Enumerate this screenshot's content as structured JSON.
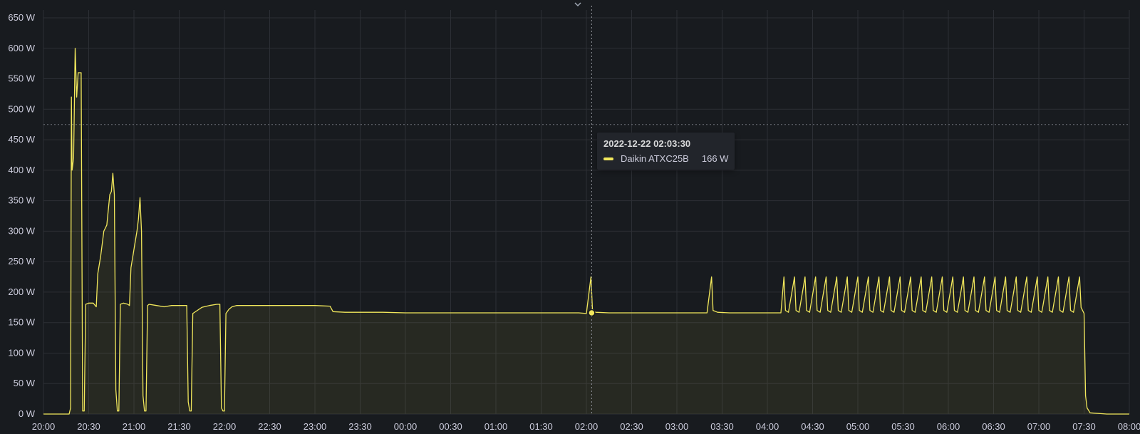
{
  "chart_data": {
    "type": "area",
    "x_axis": {
      "ticks": [
        "20:00",
        "20:30",
        "21:00",
        "21:30",
        "22:00",
        "22:30",
        "23:00",
        "23:30",
        "00:00",
        "00:30",
        "01:00",
        "01:30",
        "02:00",
        "02:30",
        "03:00",
        "03:30",
        "04:00",
        "04:30",
        "05:00",
        "05:30",
        "06:00",
        "06:30",
        "07:00",
        "07:30",
        "08:00"
      ],
      "range": [
        "2022-12-21 20:00",
        "2022-12-22 08:00"
      ]
    },
    "y_axis": {
      "unit": "W",
      "ticks": [
        "0 W",
        "50 W",
        "100 W",
        "150 W",
        "200 W",
        "250 W",
        "300 W",
        "350 W",
        "400 W",
        "450 W",
        "500 W",
        "550 W",
        "600 W",
        "650 W"
      ],
      "ylim": [
        0,
        650
      ]
    },
    "grid": true,
    "threshold_line": 475,
    "crosshair": {
      "time": "2022-12-22 02:03:30",
      "value": 166
    },
    "series": [
      {
        "name": "Daikin ATXC25B",
        "color": "#f2e85c",
        "points": [
          [
            "20:00",
            0
          ],
          [
            "20:17",
            0
          ],
          [
            "20:18",
            10
          ],
          [
            "20:18.5",
            520
          ],
          [
            "20:19",
            400
          ],
          [
            "20:20",
            420
          ],
          [
            "20:21",
            600
          ],
          [
            "20:22",
            520
          ],
          [
            "20:23",
            560
          ],
          [
            "20:24",
            560
          ],
          [
            "20:25",
            560
          ],
          [
            "20:26",
            5
          ],
          [
            "20:27",
            5
          ],
          [
            "20:28",
            180
          ],
          [
            "20:30",
            182
          ],
          [
            "20:33",
            182
          ],
          [
            "20:35",
            176
          ],
          [
            "20:36",
            230
          ],
          [
            "20:38",
            260
          ],
          [
            "20:40",
            300
          ],
          [
            "20:42",
            310
          ],
          [
            "20:44",
            360
          ],
          [
            "20:45",
            365
          ],
          [
            "20:46",
            395
          ],
          [
            "20:47",
            360
          ],
          [
            "20:48",
            40
          ],
          [
            "20:49",
            5
          ],
          [
            "20:50",
            5
          ],
          [
            "20:51",
            180
          ],
          [
            "20:53",
            182
          ],
          [
            "20:56",
            180
          ],
          [
            "20:57",
            178
          ],
          [
            "20:58",
            240
          ],
          [
            "21:00",
            270
          ],
          [
            "21:02",
            300
          ],
          [
            "21:03",
            320
          ],
          [
            "21:04",
            355
          ],
          [
            "21:05",
            300
          ],
          [
            "21:06",
            30
          ],
          [
            "21:07",
            5
          ],
          [
            "21:08",
            5
          ],
          [
            "21:09",
            178
          ],
          [
            "21:10",
            180
          ],
          [
            "21:15",
            178
          ],
          [
            "21:20",
            176
          ],
          [
            "21:25",
            178
          ],
          [
            "21:35",
            178
          ],
          [
            "21:36",
            20
          ],
          [
            "21:37",
            5
          ],
          [
            "21:38",
            5
          ],
          [
            "21:39",
            165
          ],
          [
            "21:42",
            170
          ],
          [
            "21:45",
            175
          ],
          [
            "21:50",
            178
          ],
          [
            "21:55",
            180
          ],
          [
            "21:57",
            180
          ],
          [
            "21:58",
            10
          ],
          [
            "21:59",
            5
          ],
          [
            "22:00",
            5
          ],
          [
            "22:01",
            165
          ],
          [
            "22:03",
            172
          ],
          [
            "22:05",
            176
          ],
          [
            "22:08",
            178
          ],
          [
            "22:15",
            178
          ],
          [
            "22:30",
            178
          ],
          [
            "22:45",
            178
          ],
          [
            "23:00",
            178
          ],
          [
            "23:10",
            177
          ],
          [
            "23:12",
            168
          ],
          [
            "23:20",
            167
          ],
          [
            "23:30",
            167
          ],
          [
            "23:45",
            167
          ],
          [
            "00:00",
            166
          ],
          [
            "00:30",
            166
          ],
          [
            "01:00",
            166
          ],
          [
            "01:30",
            166
          ],
          [
            "01:55",
            166
          ],
          [
            "02:00",
            165
          ],
          [
            "02:03",
            225
          ],
          [
            "02:04",
            172
          ],
          [
            "02:06",
            167
          ],
          [
            "02:15",
            166
          ],
          [
            "02:30",
            166
          ],
          [
            "02:45",
            166
          ],
          [
            "03:00",
            166
          ],
          [
            "03:15",
            166
          ],
          [
            "03:20",
            166
          ],
          [
            "03:23",
            225
          ],
          [
            "03:24",
            170
          ],
          [
            "03:27",
            167
          ],
          [
            "03:35",
            166
          ],
          [
            "03:45",
            166
          ],
          [
            "04:00",
            166
          ],
          [
            "04:09",
            166
          ],
          [
            "04:11",
            225
          ],
          [
            "04:12",
            170
          ],
          [
            "04:14",
            167
          ],
          [
            "04:18",
            225
          ],
          [
            "04:19",
            170
          ],
          [
            "04:21",
            167
          ],
          [
            "04:25",
            225
          ],
          [
            "04:26",
            170
          ],
          [
            "04:28",
            167
          ],
          [
            "04:32",
            225
          ],
          [
            "04:33",
            170
          ],
          [
            "04:35",
            167
          ],
          [
            "04:39",
            225
          ],
          [
            "04:40",
            170
          ],
          [
            "04:42",
            167
          ],
          [
            "04:46",
            225
          ],
          [
            "04:47",
            170
          ],
          [
            "04:49",
            167
          ],
          [
            "04:53",
            225
          ],
          [
            "04:54",
            170
          ],
          [
            "04:56",
            167
          ],
          [
            "05:00",
            225
          ],
          [
            "05:01",
            170
          ],
          [
            "05:03",
            167
          ],
          [
            "05:07",
            225
          ],
          [
            "05:08",
            170
          ],
          [
            "05:10",
            167
          ],
          [
            "05:14",
            225
          ],
          [
            "05:15",
            170
          ],
          [
            "05:17",
            167
          ],
          [
            "05:21",
            225
          ],
          [
            "05:22",
            170
          ],
          [
            "05:24",
            167
          ],
          [
            "05:28",
            225
          ],
          [
            "05:29",
            170
          ],
          [
            "05:31",
            167
          ],
          [
            "05:35",
            225
          ],
          [
            "05:36",
            170
          ],
          [
            "05:38",
            167
          ],
          [
            "05:42",
            225
          ],
          [
            "05:43",
            170
          ],
          [
            "05:45",
            167
          ],
          [
            "05:49",
            225
          ],
          [
            "05:50",
            170
          ],
          [
            "05:52",
            167
          ],
          [
            "05:56",
            225
          ],
          [
            "05:57",
            170
          ],
          [
            "05:59",
            167
          ],
          [
            "06:03",
            225
          ],
          [
            "06:04",
            170
          ],
          [
            "06:06",
            167
          ],
          [
            "06:10",
            225
          ],
          [
            "06:11",
            170
          ],
          [
            "06:13",
            167
          ],
          [
            "06:17",
            225
          ],
          [
            "06:18",
            170
          ],
          [
            "06:20",
            167
          ],
          [
            "06:24",
            225
          ],
          [
            "06:25",
            170
          ],
          [
            "06:27",
            167
          ],
          [
            "06:31",
            225
          ],
          [
            "06:32",
            170
          ],
          [
            "06:34",
            167
          ],
          [
            "06:38",
            225
          ],
          [
            "06:39",
            170
          ],
          [
            "06:41",
            167
          ],
          [
            "06:45",
            225
          ],
          [
            "06:46",
            170
          ],
          [
            "06:48",
            167
          ],
          [
            "06:52",
            225
          ],
          [
            "06:53",
            170
          ],
          [
            "06:55",
            167
          ],
          [
            "06:59",
            225
          ],
          [
            "07:00",
            170
          ],
          [
            "07:02",
            167
          ],
          [
            "07:06",
            225
          ],
          [
            "07:07",
            170
          ],
          [
            "07:09",
            167
          ],
          [
            "07:13",
            225
          ],
          [
            "07:14",
            170
          ],
          [
            "07:16",
            167
          ],
          [
            "07:20",
            225
          ],
          [
            "07:21",
            170
          ],
          [
            "07:23",
            167
          ],
          [
            "07:27",
            225
          ],
          [
            "07:28",
            175
          ],
          [
            "07:30",
            165
          ],
          [
            "07:31",
            30
          ],
          [
            "07:32",
            10
          ],
          [
            "07:34",
            2
          ],
          [
            "07:45",
            0
          ],
          [
            "08:00",
            0
          ]
        ]
      }
    ]
  },
  "tooltip": {
    "time": "2022-12-22 02:03:30",
    "series_name": "Daikin ATXC25B",
    "value": "166 W",
    "color": "#f2e85c"
  },
  "icons": {
    "chevron": "chevron-down-icon"
  }
}
